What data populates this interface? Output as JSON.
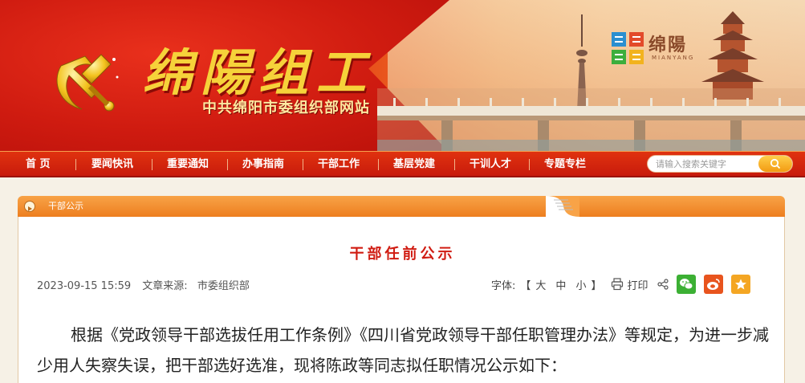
{
  "header": {
    "site_title": "绵陽组工",
    "site_subtitle": "中共绵阳市委组织部网站",
    "city_logo_text": "绵陽",
    "city_logo_en": "MIANYANG"
  },
  "nav": {
    "items": [
      {
        "label": "首 页"
      },
      {
        "label": "要闻快讯"
      },
      {
        "label": "重要通知"
      },
      {
        "label": "办事指南"
      },
      {
        "label": "干部工作"
      },
      {
        "label": "基层党建"
      },
      {
        "label": "干训人才"
      },
      {
        "label": "专题专栏"
      }
    ],
    "search_placeholder": "请输入搜索关键字"
  },
  "breadcrumb": {
    "label": "干部公示"
  },
  "article": {
    "title": "干部任前公示",
    "date": "2023-09-15 15:59",
    "source_label": "文章来源:",
    "source": "市委组织部",
    "font_label": "字体:",
    "bracket_open": "【",
    "bracket_close": "】",
    "sizes": [
      "大",
      "中",
      "小"
    ],
    "print_label": "打印",
    "body": "根据《党政领导干部选拔任用工作条例》《四川省党政领导干部任职管理办法》等规定，为进一步减少用人失察失误，把干部选好选准，现将陈政等同志拟任职情况公示如下："
  },
  "colors": {
    "primary_red": "#c81b0c",
    "accent_orange": "#ed7e1f",
    "title_red": "#d01c12",
    "wechat_green": "#3cb034",
    "weibo_orange": "#e8541e",
    "favorite_orange": "#f4a623"
  },
  "icons": {
    "emblem": "party-emblem-icon",
    "search": "search-icon",
    "print": "printer-icon",
    "share": "share-icon",
    "wechat": "wechat-icon",
    "weibo": "weibo-icon",
    "favorite": "star-icon"
  }
}
